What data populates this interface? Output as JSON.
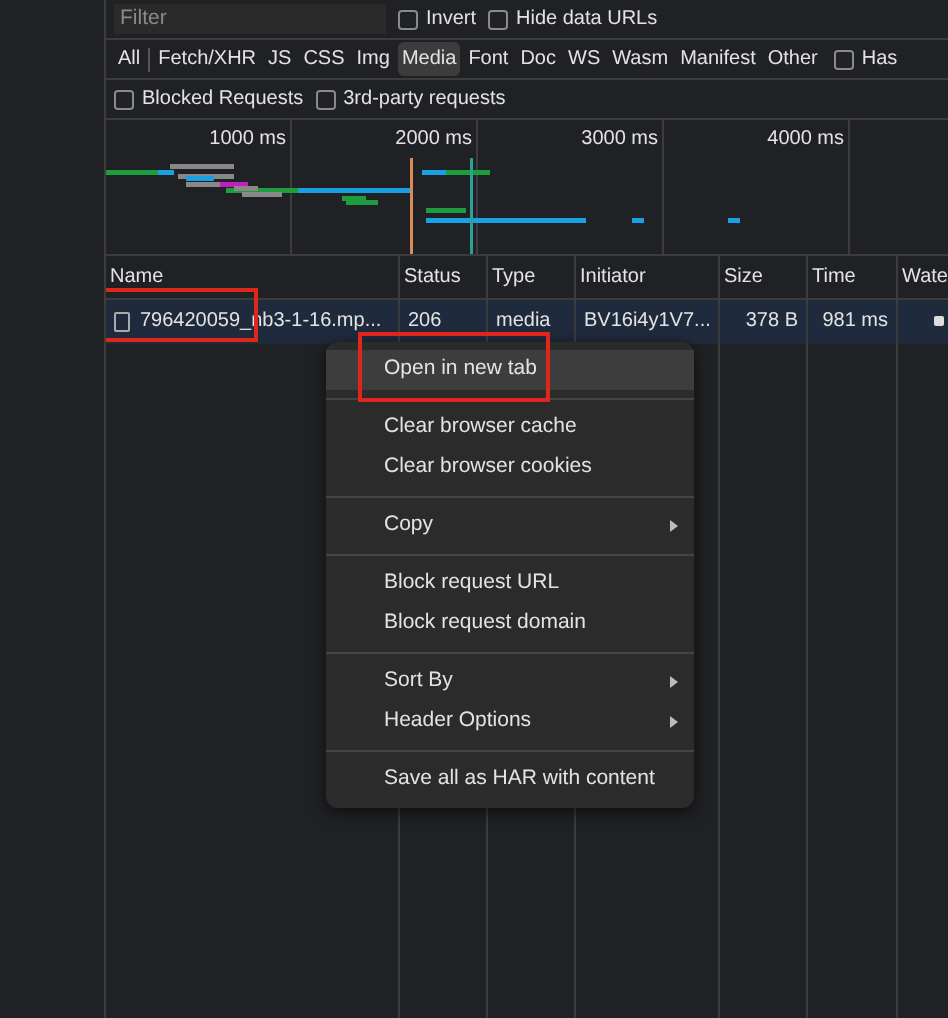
{
  "filter": {
    "placeholder": "Filter"
  },
  "filter_options": [
    {
      "label": "Invert",
      "checked": false
    },
    {
      "label": "Hide data URLs",
      "checked": false
    }
  ],
  "type_filters": [
    {
      "label": "All",
      "selected": false
    },
    {
      "label": "Fetch/XHR",
      "selected": false
    },
    {
      "label": "JS",
      "selected": false
    },
    {
      "label": "CSS",
      "selected": false
    },
    {
      "label": "Img",
      "selected": false
    },
    {
      "label": "Media",
      "selected": true
    },
    {
      "label": "Font",
      "selected": false
    },
    {
      "label": "Doc",
      "selected": false
    },
    {
      "label": "WS",
      "selected": false
    },
    {
      "label": "Wasm",
      "selected": false
    },
    {
      "label": "Manifest",
      "selected": false
    },
    {
      "label": "Other",
      "selected": false
    }
  ],
  "has_option": {
    "label": "Has",
    "checked": false
  },
  "request_options": [
    {
      "label": "Blocked Requests",
      "checked": false
    },
    {
      "label": "3rd-party requests",
      "checked": false
    }
  ],
  "overview": {
    "ticks": [
      "1000 ms",
      "2000 ms",
      "3000 ms",
      "4000 ms"
    ]
  },
  "table": {
    "columns": [
      "Name",
      "Status",
      "Type",
      "Initiator",
      "Size",
      "Time",
      "Wate"
    ],
    "rows": [
      {
        "cells": [
          "796420059_nb3-1-16.mp...",
          "206",
          "media",
          "BV16i4y1V7...",
          "378 B",
          "981 ms"
        ],
        "selected": true,
        "highlighted": true
      }
    ]
  },
  "context_menu": {
    "groups": [
      [
        {
          "label": "Open in new tab",
          "has_submenu": false,
          "hovered": true,
          "highlighted": true
        }
      ],
      [
        {
          "label": "Clear browser cache",
          "has_submenu": false,
          "hovered": false,
          "highlighted": false
        },
        {
          "label": "Clear browser cookies",
          "has_submenu": false,
          "hovered": false,
          "highlighted": false
        }
      ],
      [
        {
          "label": "Copy",
          "has_submenu": true,
          "hovered": false,
          "highlighted": false
        }
      ],
      [
        {
          "label": "Block request URL",
          "has_submenu": false,
          "hovered": false,
          "highlighted": false
        },
        {
          "label": "Block request domain",
          "has_submenu": false,
          "hovered": false,
          "highlighted": false
        }
      ],
      [
        {
          "label": "Sort By",
          "has_submenu": true,
          "hovered": false,
          "highlighted": false
        },
        {
          "label": "Header Options",
          "has_submenu": true,
          "hovered": false,
          "highlighted": false
        }
      ],
      [
        {
          "label": "Save all as HAR with content",
          "has_submenu": false,
          "hovered": false,
          "highlighted": false
        }
      ]
    ]
  }
}
